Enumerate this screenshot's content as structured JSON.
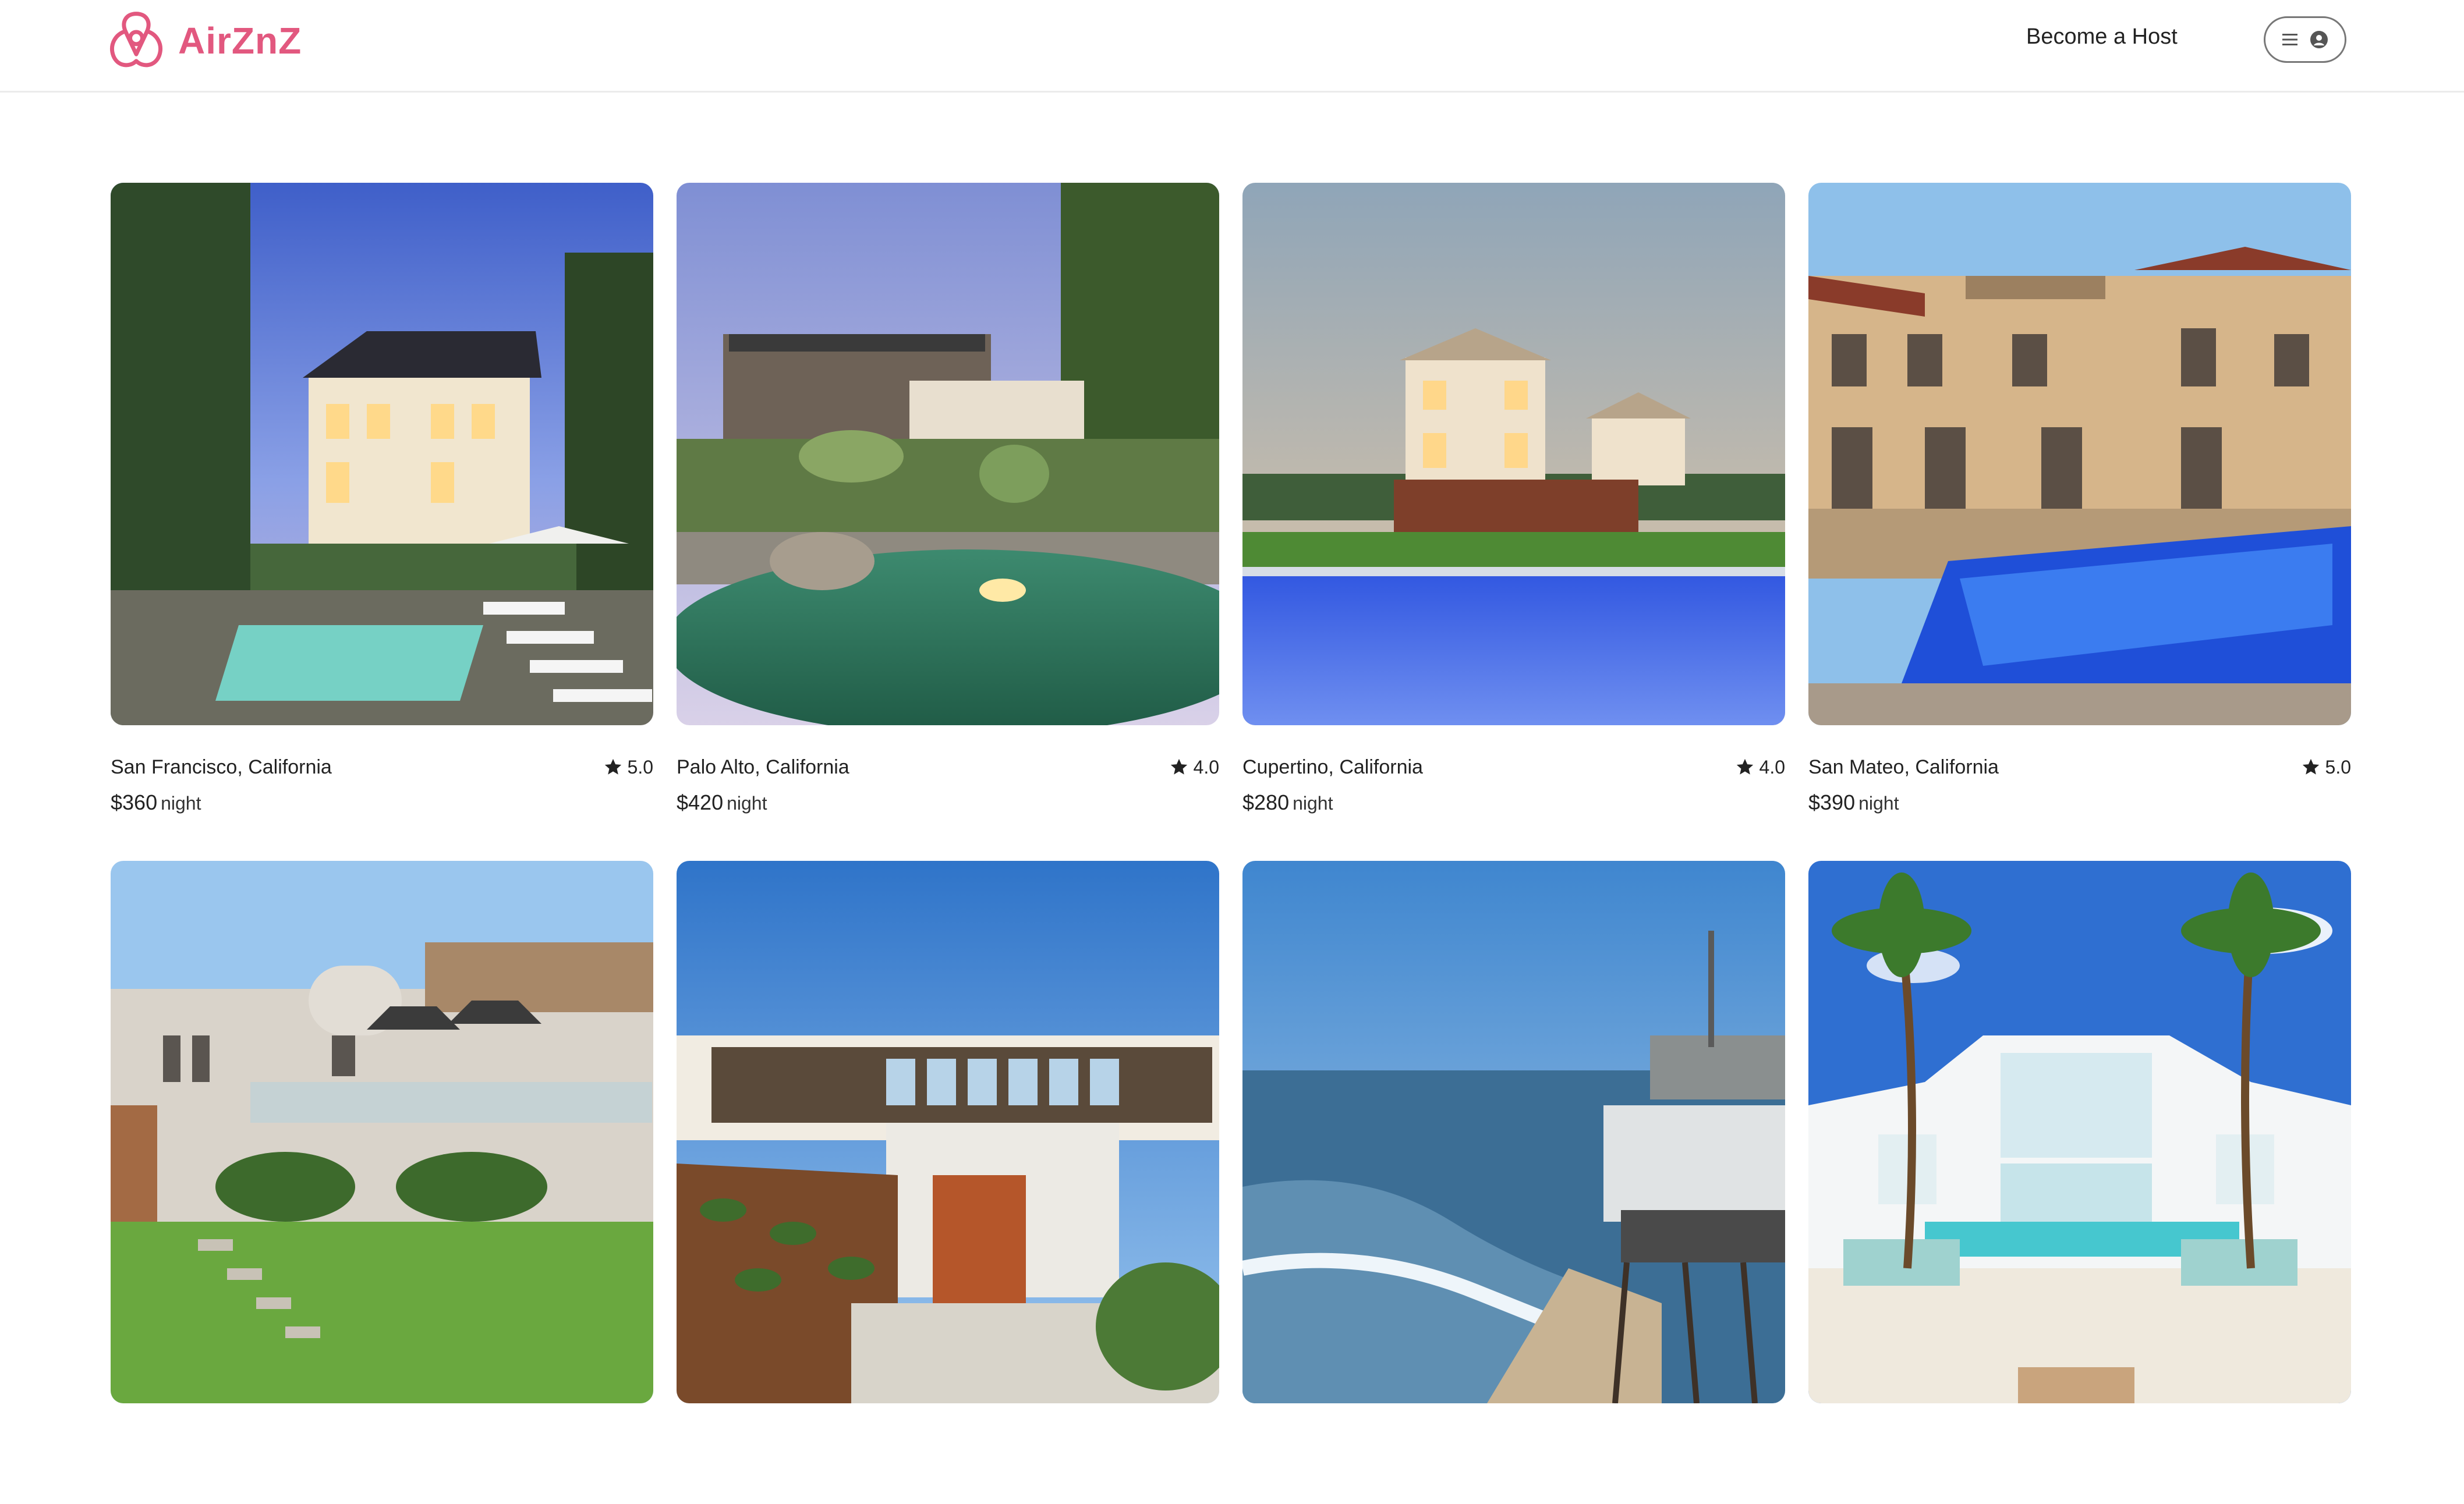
{
  "header": {
    "logo_text": "AirZnZ",
    "logo_icon": "airznz-logo-icon",
    "become_host_label": "Become a Host",
    "menu_icon": "hamburger-icon",
    "profile_icon": "user-icon"
  },
  "colors": {
    "brand": "#e2587f",
    "text": "#222222",
    "border": "#ebebeb"
  },
  "listings": [
    {
      "location": "San Francisco, California",
      "rating": "5.0",
      "price": "$360",
      "unit": "night"
    },
    {
      "location": "Palo Alto, California",
      "rating": "4.0",
      "price": "$420",
      "unit": "night"
    },
    {
      "location": "Cupertino, California",
      "rating": "4.0",
      "price": "$280",
      "unit": "night"
    },
    {
      "location": "San Mateo, California",
      "rating": "5.0",
      "price": "$390",
      "unit": "night"
    },
    {
      "location": "",
      "rating": "",
      "price": "",
      "unit": ""
    },
    {
      "location": "",
      "rating": "",
      "price": "",
      "unit": ""
    },
    {
      "location": "",
      "rating": "",
      "price": "",
      "unit": ""
    },
    {
      "location": "",
      "rating": "",
      "price": "",
      "unit": ""
    }
  ]
}
